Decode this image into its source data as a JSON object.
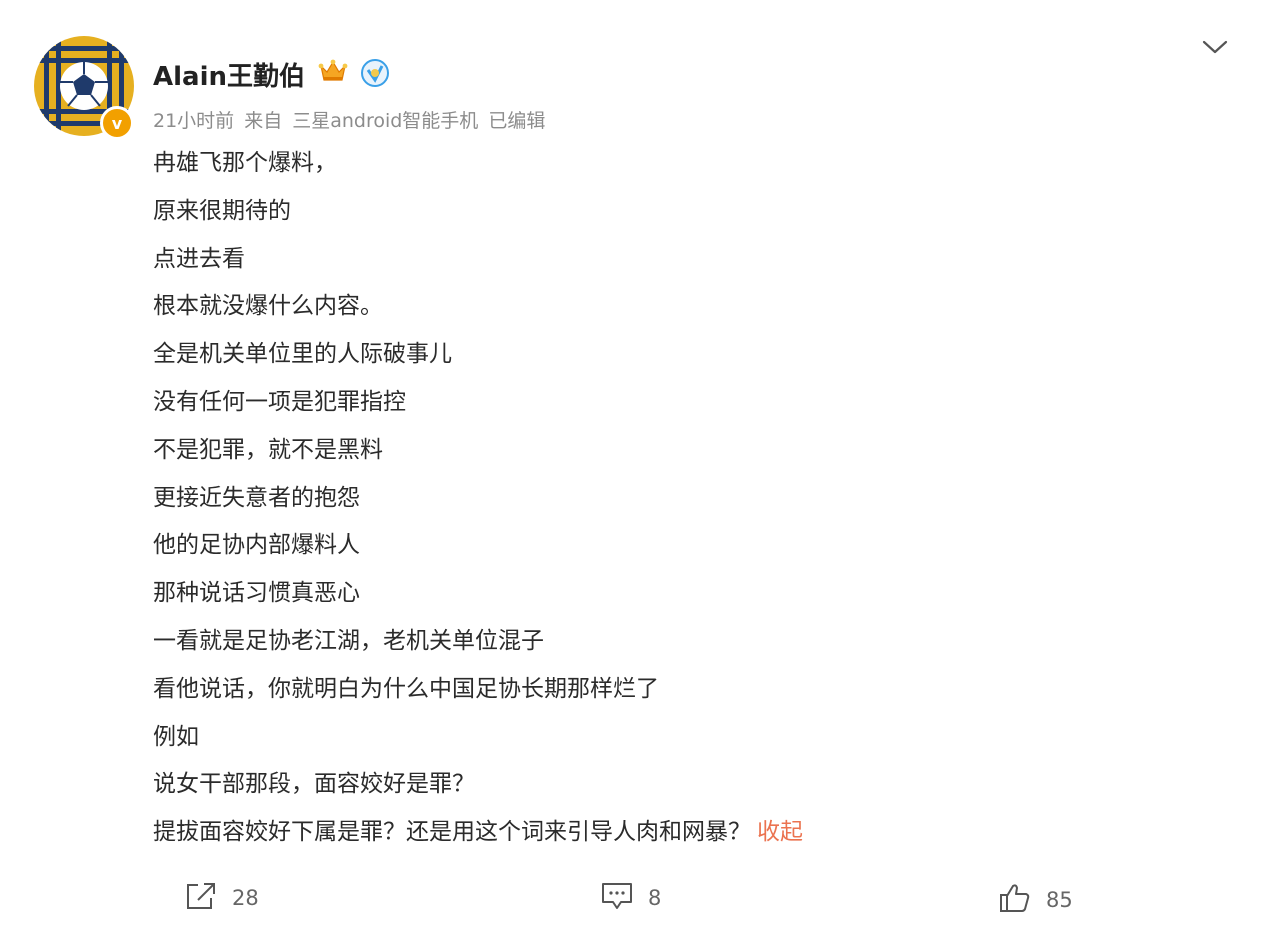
{
  "user": {
    "name": "Alain王勤伯",
    "badge_letter": "v",
    "colors": {
      "avatar_yellow": "#e6b020",
      "avatar_navy": "#1f3a6b",
      "badge_orange": "#f2a000",
      "blue_v": "#3aa0e8"
    }
  },
  "meta": {
    "time": "21小时前",
    "source_prefix": "来自",
    "source": "三星android智能手机",
    "edited": "已编辑"
  },
  "post": {
    "lines": [
      "冉雄飞那个爆料，",
      "原来很期待的",
      "点进去看",
      "根本就没爆什么内容。",
      "全是机关单位里的人际破事儿",
      "没有任何一项是犯罪指控",
      "不是犯罪，就不是黑料",
      "更接近失意者的抱怨",
      "他的足协内部爆料人",
      "那种说话习惯真恶心",
      "一看就是足协老江湖，老机关单位混子",
      "看他说话，你就明白为什么中国足协长期那样烂了",
      "例如",
      "说女干部那段，面容姣好是罪？",
      "提拔面容姣好下属是罪？还是用这个词来引导人肉和网暴？"
    ],
    "collapse_label": "收起",
    "collapse_color": "#eb7350"
  },
  "actions": {
    "forward_count": "28",
    "comment_count": "8",
    "like_count": "85"
  },
  "icons": [
    "avatar",
    "crown-icon",
    "blue-v-icon",
    "chevron-down-icon",
    "forward-icon",
    "comment-icon",
    "like-icon"
  ]
}
